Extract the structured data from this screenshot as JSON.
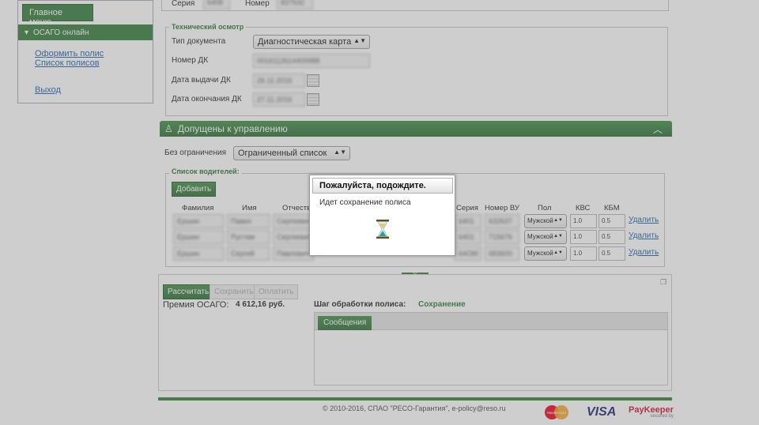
{
  "sidebar": {
    "main_menu_label": "Главное меню",
    "section_label": "ОСАГО онлайн",
    "links": [
      "Оформить полис",
      "Список полисов",
      "Выход"
    ]
  },
  "top_fields": {
    "series_label": "Серия",
    "series_value": "6408",
    "number_label": "Номер",
    "number_value": "837632"
  },
  "tech_inspection": {
    "legend": "Технический осмотр",
    "doc_type_label": "Тип документа",
    "doc_type_value": "Диагностическая карта",
    "dk_number_label": "Номер ДК",
    "dk_number_value": "0016112614400988",
    "issue_date_label": "Дата выдачи ДК",
    "issue_date_value": "26.11.2016",
    "expiry_date_label": "Дата окончания ДК",
    "expiry_date_value": "27.11.2016"
  },
  "drivers": {
    "header": "Допущены к управлению",
    "restriction_label": "Без ограничения",
    "restriction_value": "Ограниченный список",
    "list_legend": "Список водителей:",
    "add_button": "Добавить",
    "columns": [
      "Фамилия",
      "Имя",
      "Отчество",
      "Серия",
      "Номер ВУ",
      "Пол",
      "КВС",
      "КБМ"
    ],
    "rows": [
      {
        "last": "Ершин",
        "first": "Павел",
        "middle": "Сергеевич",
        "series": "6401",
        "number": "632637",
        "gender": "Мужской",
        "kvs": "1.0",
        "kbm": "0.5",
        "delete": "Удалить"
      },
      {
        "last": "Ершин",
        "first": "Рустам",
        "middle": "Сергеевич",
        "series": "6401",
        "number": "715676",
        "gender": "Мужской",
        "kvs": "1.0",
        "kbm": "0.5",
        "delete": "Удалить"
      },
      {
        "last": "Ершин",
        "first": "Сергей",
        "middle": "Павлович",
        "series": "64ОМ",
        "number": "683600",
        "gender": "Мужской",
        "kvs": "1.0",
        "kbm": "0.5",
        "delete": "Удалить"
      }
    ]
  },
  "bottom": {
    "calc_button": "Рассчитать",
    "save_button": "Сохранить",
    "pay_button": "Оплатить",
    "premium_label": "Премия ОСАГО:",
    "premium_value": "4 612,16 руб.",
    "step_label": "Шаг обработки полиса:",
    "step_value": "Сохранение",
    "messages_tab": "Сообщения"
  },
  "footer": {
    "copyright": "© 2010-2016, СПАО \"РЕСО-Гарантия\", e-policy@reso.ru",
    "logos": [
      "MasterCard",
      "VISA",
      "PayKeeper"
    ],
    "paykeeper_sub": "secured by"
  },
  "dialog": {
    "title": "Пожалуйста, подождите.",
    "message": "Идет сохранение полиса",
    "icon": "hourglass-icon"
  },
  "colors": {
    "brand_green": "#2f7a35",
    "link_blue": "#1a5fa8"
  }
}
